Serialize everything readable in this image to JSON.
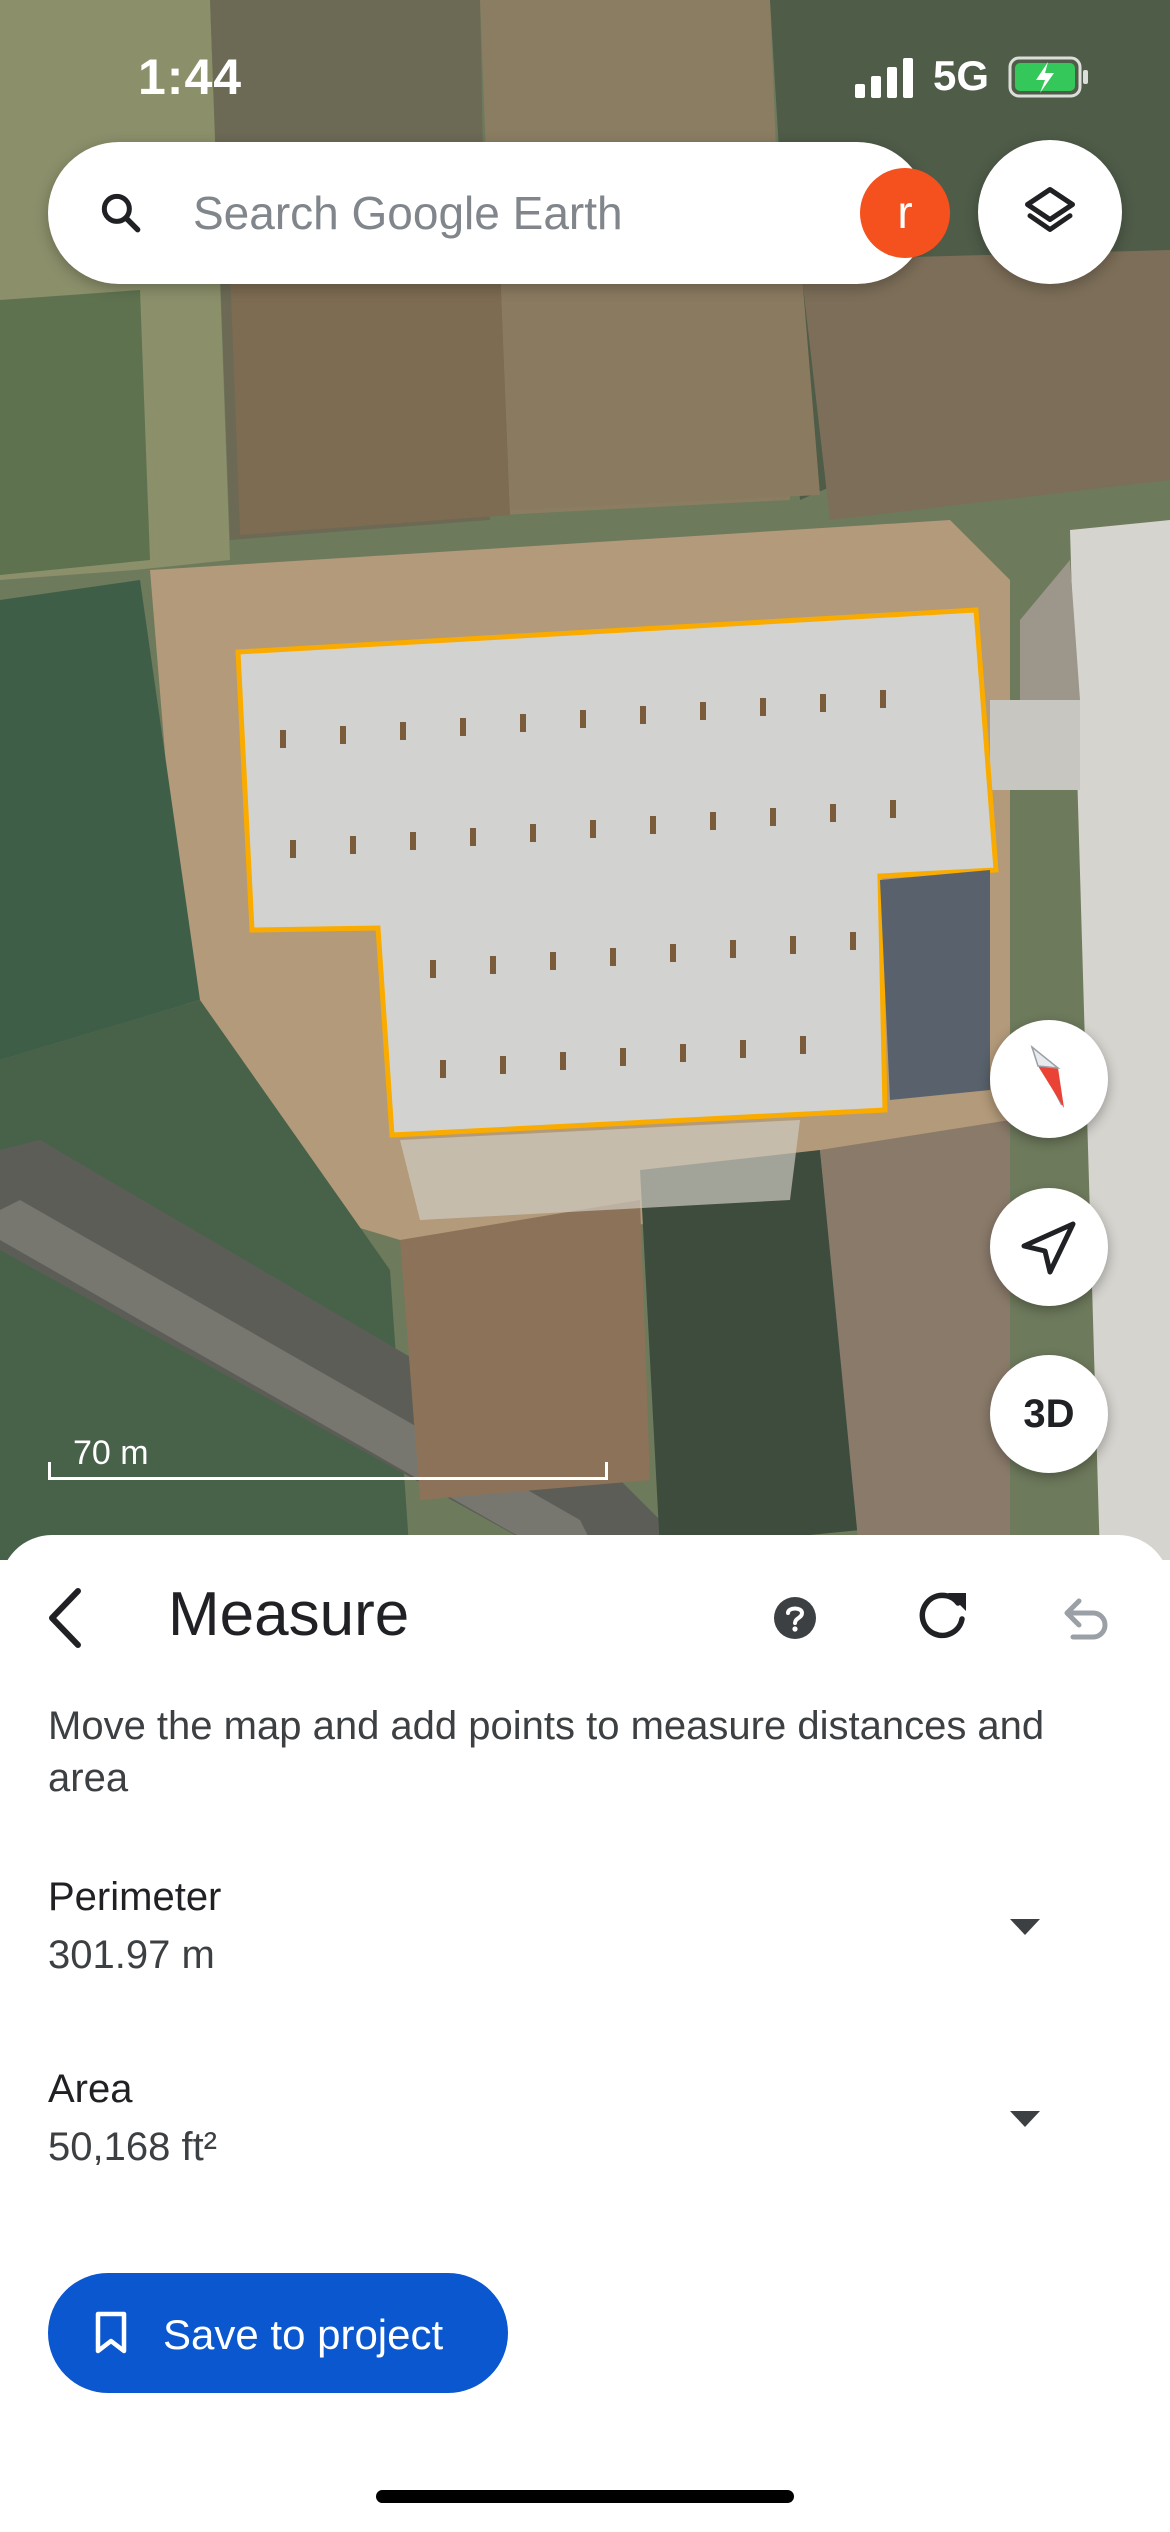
{
  "status_bar": {
    "time": "1:44",
    "network": "5G"
  },
  "search": {
    "placeholder": "Search Google Earth",
    "avatar_letter": "r"
  },
  "map": {
    "scale_label": "70 m",
    "view_3d_label": "3D"
  },
  "measure": {
    "title": "Measure",
    "description": "Move the map and add points to measure distances and area",
    "metrics": [
      {
        "label": "Perimeter",
        "value": "301.97 m"
      },
      {
        "label": "Area",
        "value": "50,168 ft²"
      }
    ],
    "save_label": "Save to project"
  },
  "colors": {
    "accent": "#0b57d0",
    "avatar": "#f4511e",
    "outline": "#f9ab00"
  },
  "icons": [
    "search-icon",
    "layers-icon",
    "compass-icon",
    "my-location-icon",
    "back-icon",
    "help-icon",
    "refresh-icon",
    "undo-icon",
    "bookmark-icon",
    "chevron-down-icon"
  ]
}
